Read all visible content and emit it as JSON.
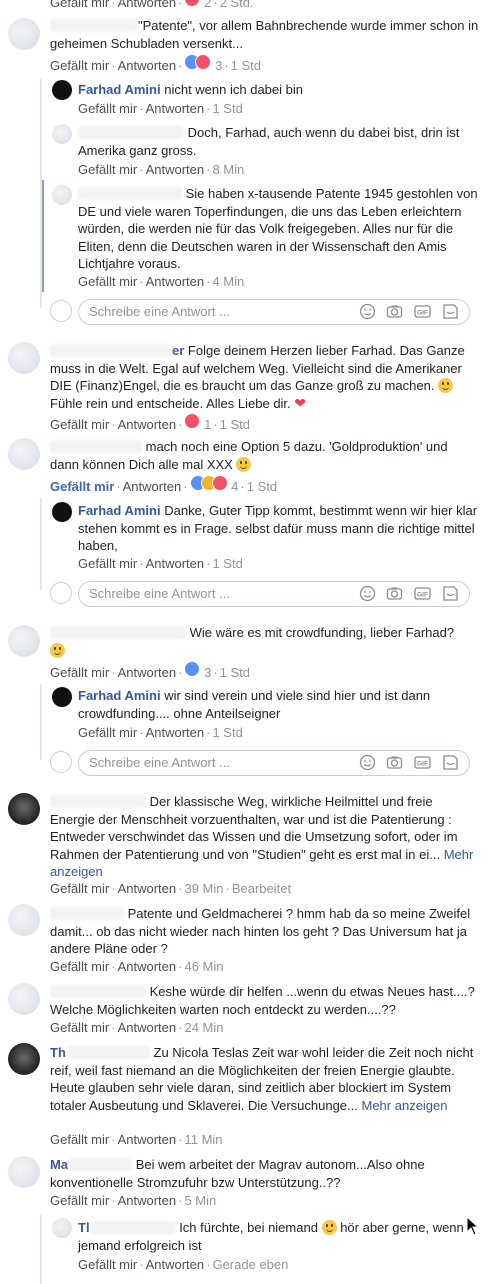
{
  "ui": {
    "like": "Gefällt mir",
    "reply": "Antworten",
    "sep": "·",
    "more": "Mehr anzeigen",
    "reply_placeholder": "Schreibe eine Antwort ...",
    "edited": "Bearbeitet"
  },
  "c0": {
    "name": "Gefällt mir",
    "reply": "Antworten",
    "count": "2",
    "time": "2 Std."
  },
  "c1": {
    "text": "\"Patente\", vor allem Bahnbrechende wurde immer schon in geheimen Schubladen versenkt...",
    "count": "3",
    "time": "1 Std"
  },
  "r1a": {
    "name": "Farhad Amini",
    "text": "nicht wenn ich dabei bin",
    "time": "1 Std"
  },
  "r1b": {
    "text": "Doch, Farhad, auch wenn du dabei bist, drin ist Amerika ganz gross.",
    "time": "8 Min"
  },
  "r1c": {
    "text": "Sie haben x-tausende Patente 1945 gestohlen von DE und viele waren Toperfindungen, die uns das Leben erleichtern würden, die werden nie für das Volk freigegeben. Alles nur für die Eliten, denn die Deutschen waren in der Wissenschaft den Amis Lichtjahre voraus.",
    "time": "4 Min"
  },
  "c2": {
    "name_tail": "er",
    "text1": "Folge deinem Herzen lieber Farhad. Das Ganze muss in die Welt. Egal auf welchem Weg. Vielleicht sind die Amerikaner DIE (Finanz)Engel, die es braucht um das Ganze groß zu machen.",
    "text2": "Fühle rein und entscheide. Alles Liebe dir.",
    "count": "1",
    "time": "1 Std"
  },
  "c3": {
    "text": "mach noch eine Option 5 dazu. 'Goldproduktion' und dann können Dich alle mal XXX",
    "count": "4",
    "time": "1 Std"
  },
  "r3a": {
    "name": "Farhad Amini",
    "text": "Danke, Guter Tipp kommt, bestimmt wenn wir hier klar stehen kommt es in Frage. selbst dafür muss mann die richtige mittel haben,",
    "time": "1 Std"
  },
  "c4": {
    "text": "Wie wäre es mit crowdfunding, lieber Farhad?",
    "count": "3",
    "time": "1 Std"
  },
  "r4a": {
    "name": "Farhad Amini",
    "text": "wir sind verein und viele sind hier und ist dann crowdfunding.... ohne Anteilseigner",
    "time": "1 Std"
  },
  "c5": {
    "text": "Der klassische Weg, wirkliche Heilmittel und freie Energie der Menschheit vorzuenthalten, war und ist die Patentierung : Entweder verschwindet das Wissen und die Umsetzung sofort, oder im Rahmen der Patentierung und von \"Studien\" geht es erst mal in ei...",
    "time": "39 Min"
  },
  "c6": {
    "text": "Patente und Geldmacherei ? hmm hab da so meine Zweifel damit... ob das nicht wieder nach hinten los geht ? Das Universum hat ja andere Pläne oder ?",
    "time": "46 Min"
  },
  "c7": {
    "text": "Keshe würde dir helfen ...wenn du etwas Neues hast....? Welche Möglichkeiten warten noch entdeckt zu werden....??",
    "time": "24 Min"
  },
  "c8": {
    "name_head": "Th",
    "text": "Zu Nicola Teslas Zeit war wohl leider die Zeit noch nicht reif, weil fast niemand an die Möglichkeiten der freien Energie glaubte. Heute glauben sehr viele daran, sind zeitlich aber blockiert im System totaler Ausbeutung und Sklaverei. Die Versuchunge...",
    "time": "11 Min"
  },
  "c9": {
    "name_head": "Ma",
    "text": "Bei wem arbeitet der Magrav autonom...Also ohne konventionelle Stromzufuhr bzw Unterstützung..??",
    "time": "5 Min"
  },
  "r9a": {
    "name_head": "Tl",
    "text1": "Ich fürchte, bei niemand",
    "text2": "hör aber gerne, wenn jemand erfolgreich ist",
    "time": "Gerade eben"
  }
}
